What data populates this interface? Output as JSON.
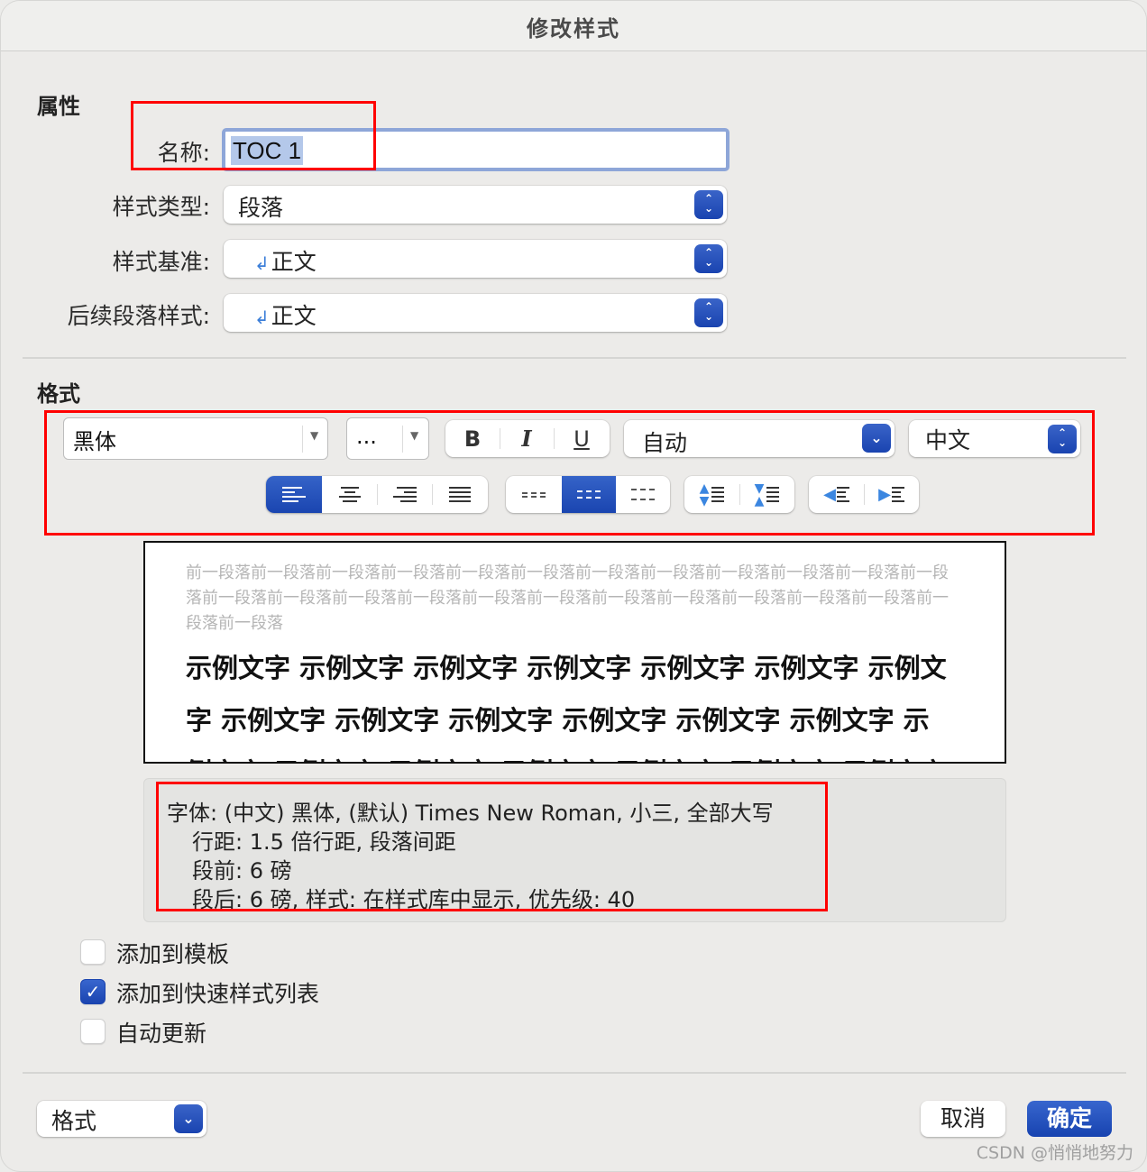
{
  "window": {
    "title": "修改样式"
  },
  "properties": {
    "section_title": "属性",
    "name_label": "名称:",
    "name_value": "TOC 1",
    "style_type_label": "样式类型:",
    "style_type_value": "段落",
    "based_on_label": "样式基准:",
    "based_on_value": "正文",
    "next_style_label": "后续段落样式:",
    "next_style_value": "正文",
    "paragraph_mark_glyph": "↲"
  },
  "format": {
    "section_title": "格式",
    "font_name": "黑体",
    "font_size": "...",
    "bold_label": "B",
    "italic_label": "I",
    "underline_label": "U",
    "font_color": "自动",
    "script": "中文",
    "alignment": {
      "options": [
        "align-left",
        "align-center",
        "align-right",
        "justify"
      ],
      "selected": "align-left"
    },
    "line_spacing": {
      "options": [
        "single",
        "one-and-half",
        "double"
      ],
      "selected": "one-and-half"
    },
    "paragraph_spacing": [
      "increase-spacing",
      "decrease-spacing"
    ],
    "indent": [
      "decrease-indent",
      "increase-indent"
    ]
  },
  "preview": {
    "previous_paragraph": "前一段落前一段落前一段落前一段落前一段落前一段落前一段落前一段落前一段落前一段落前一段落前一段落前一段落前一段落前一段落前一段落前一段落前一段落前一段落前一段落前一段落前一段落前一段落前一段落前一段落",
    "sample_text": "示例文字 示例文字 示例文字 示例文字 示例文字 示例文字 示例文字 示例文字 示例文字 示例文字 示例文字 示例文字 示例文字 示例文字 示例文字 示例文字 示例文字 示例文字 示例文字 示例文字"
  },
  "description": {
    "line1": "字体: (中文) 黑体, (默认) Times New Roman, 小三, 全部大写",
    "line2": "行距: 1.5 倍行距, 段落间距",
    "line3": "段前: 6 磅",
    "line4": "段后: 6 磅, 样式: 在样式库中显示, 优先级: 40"
  },
  "options": [
    {
      "label": "添加到模板",
      "checked": false
    },
    {
      "label": "添加到快速样式列表",
      "checked": true
    },
    {
      "label": "自动更新",
      "checked": false
    }
  ],
  "footer": {
    "format_menu": "格式",
    "cancel": "取消",
    "ok": "确定"
  },
  "watermark": "CSDN @悄悄地努力",
  "colors": {
    "accent": "#1a44b0",
    "highlight_box": "#ff0000",
    "selection": "#b4c8ea"
  }
}
